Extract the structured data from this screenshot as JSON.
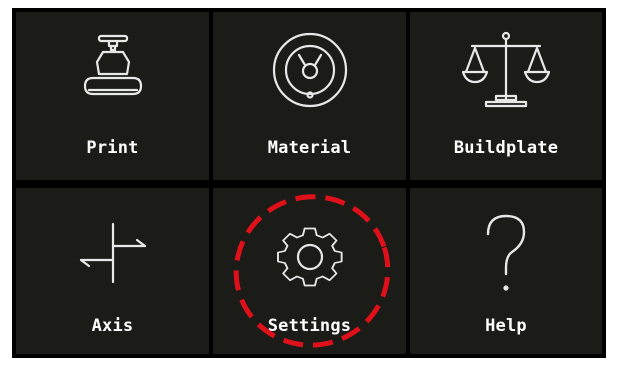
{
  "menu": {
    "tiles": [
      {
        "label": "Print",
        "icon": "print-head-icon"
      },
      {
        "label": "Material",
        "icon": "material-spool-icon"
      },
      {
        "label": "Buildplate",
        "icon": "balance-scale-icon"
      },
      {
        "label": "Axis",
        "icon": "axis-arrows-icon"
      },
      {
        "label": "Settings",
        "icon": "gear-icon"
      },
      {
        "label": "Help",
        "icon": "question-mark-icon"
      }
    ]
  },
  "annotation": {
    "highlight_target": "Settings",
    "highlight_style": "red-dashed-circle",
    "highlight_color": "#e0101a"
  },
  "colors": {
    "tile_background": "#1b1c18",
    "divider": "#000000",
    "icon_stroke": "#e8e8e8",
    "label_text": "#ffffff"
  }
}
